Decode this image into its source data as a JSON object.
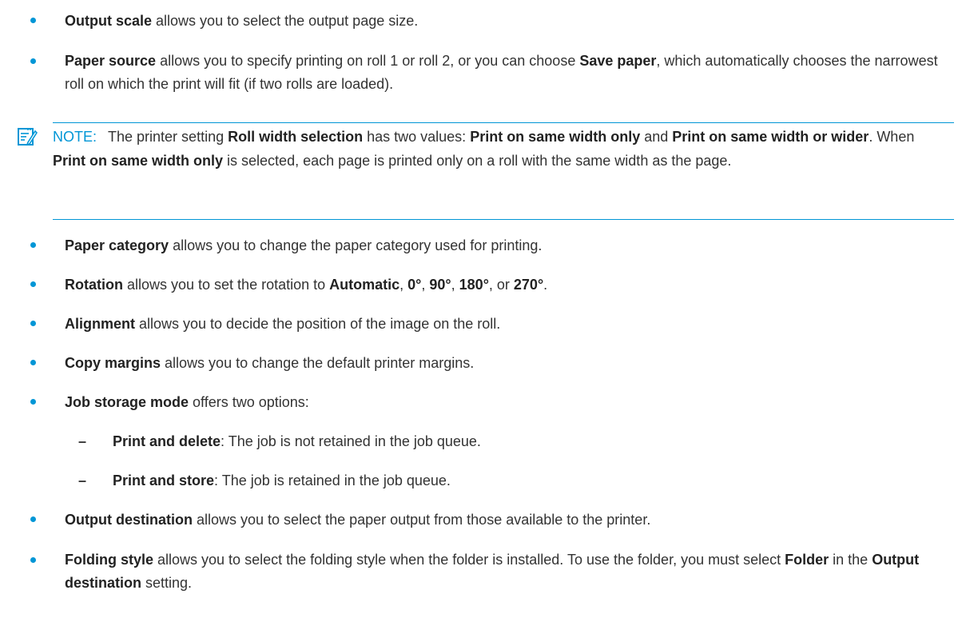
{
  "items": [
    {
      "label": "Output scale",
      "text": " allows you to select the output page size."
    },
    {
      "label": "Paper source",
      "text1": " allows you to specify printing on roll 1 or roll 2, or you can choose ",
      "bold1": "Save paper",
      "text2": ", which automatically chooses the narrowest roll on which the print will fit (if two rolls are loaded)."
    },
    {
      "label": "Paper category",
      "text": " allows you to change the paper category used for printing."
    },
    {
      "label": "Rotation",
      "text1": " allows you to set the rotation to ",
      "opt1": "Automatic",
      "sep1": ", ",
      "opt2": "0°",
      "sep2": ", ",
      "opt3": "90°",
      "sep3": ", ",
      "opt4": "180°",
      "sep4": ", or ",
      "opt5": "270°",
      "end": "."
    },
    {
      "label": "Alignment",
      "text": " allows you to decide the position of the image on the roll."
    },
    {
      "label": "Copy margins",
      "text": " allows you to change the default printer margins."
    },
    {
      "label": "Job storage mode",
      "text": " offers two options:"
    },
    {
      "label": "Output destination",
      "text": " allows you to select the paper output from those available to the printer."
    },
    {
      "label": "Folding style",
      "text1": " allows you to select the folding style when the folder is installed. To use the folder, you must select ",
      "bold1": "Folder",
      "text2": " in the ",
      "bold2": "Output destination",
      "text3": " setting."
    }
  ],
  "sub_items": [
    {
      "dash": "–",
      "label": "Print and delete",
      "text": ": The job is not retained in the job queue."
    },
    {
      "dash": "–",
      "label": "Print and store",
      "text": ": The job is retained in the job queue."
    }
  ],
  "note": {
    "icon": "note-icon",
    "label": "NOTE:",
    "t1": "The printer setting ",
    "b1": "Roll width selection",
    "t2": " has two values: ",
    "b2": "Print on same width only",
    "t3": " and ",
    "b3": "Print on same width or wider",
    "t4": ". When ",
    "b4": "Print on same width only",
    "t5": " is selected, each page is printed only on a roll with the same width as the page."
  },
  "colors": {
    "accent": "#0096d6",
    "text": "#333333"
  }
}
